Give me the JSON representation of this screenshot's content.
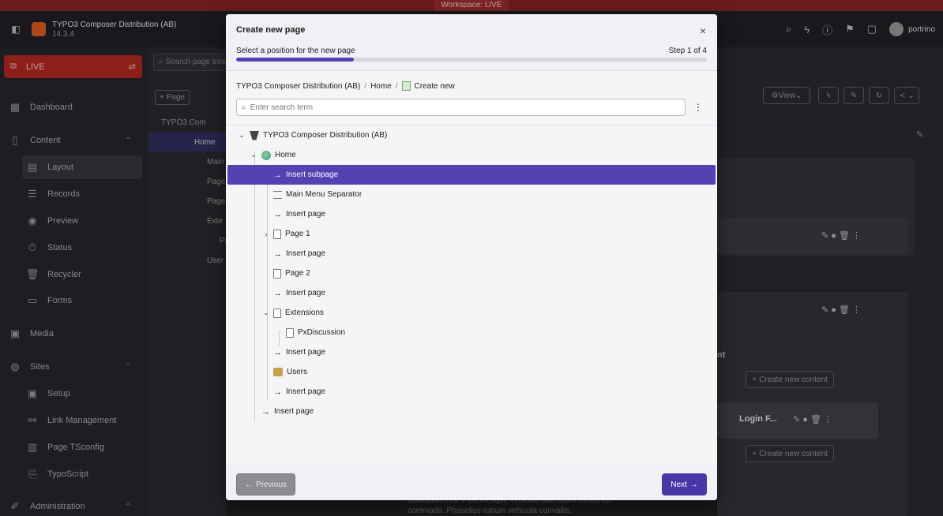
{
  "workspace": {
    "label": "Workspace: LIVE"
  },
  "topbar": {
    "site_name": "TYPO3 Composer Distribution (AB)",
    "site_version": "14.3.4",
    "user": "portrino"
  },
  "sidebar": {
    "live_label": "LIVE",
    "items": [
      {
        "label": "Dashboard",
        "icon": "dashboard-icon"
      },
      {
        "label": "Content",
        "icon": "content-icon"
      },
      {
        "label": "Layout",
        "icon": "layout-icon"
      },
      {
        "label": "Records",
        "icon": "records-icon"
      },
      {
        "label": "Preview",
        "icon": "preview-icon"
      },
      {
        "label": "Status",
        "icon": "status-icon"
      },
      {
        "label": "Recycler",
        "icon": "recycler-icon"
      },
      {
        "label": "Forms",
        "icon": "forms-icon"
      },
      {
        "label": "Media",
        "icon": "media-icon"
      },
      {
        "label": "Sites",
        "icon": "sites-icon"
      },
      {
        "label": "Setup",
        "icon": "setup-icon"
      },
      {
        "label": "Link Management",
        "icon": "link-icon"
      },
      {
        "label": "Page TSconfig",
        "icon": "tsconfig-icon"
      },
      {
        "label": "TypoScript",
        "icon": "typoscript-icon"
      },
      {
        "label": "Administration",
        "icon": "admin-icon"
      }
    ]
  },
  "pagetree": {
    "search_placeholder": "Search page tree",
    "page_button": "Page",
    "rows": [
      "TYPO3 Com",
      "Home",
      "Main",
      "Page",
      "Page",
      "Exte",
      "Px",
      "User"
    ]
  },
  "module": {
    "view_label": "View",
    "create_content": "Create new content",
    "login_item": "Login F...",
    "behind_text": "sollicitudin nisi. Pellentesque vehicula bibendum metus eu commodo. Phasellus rutrum vehicula convallis.",
    "col_title": "nt"
  },
  "modal": {
    "title": "Create new page",
    "step_label": "Select a position for the new page",
    "step_count": "Step 1 of 4",
    "progress": 0.25,
    "breadcrumb": [
      "TYPO3 Composer Distribution (AB)",
      "Home",
      "Create new"
    ],
    "search_placeholder": "Enter search term",
    "tree": [
      {
        "label": "TYPO3 Composer Distribution (AB)",
        "type": "root"
      },
      {
        "label": "Home",
        "type": "globe"
      },
      {
        "label": "Insert subpage",
        "type": "insert",
        "selected": true
      },
      {
        "label": "Main Menu Separator",
        "type": "separator"
      },
      {
        "label": "Insert page",
        "type": "insert"
      },
      {
        "label": "Page 1",
        "type": "page"
      },
      {
        "label": "Insert page",
        "type": "insert"
      },
      {
        "label": "Page 2",
        "type": "page"
      },
      {
        "label": "Insert page",
        "type": "insert"
      },
      {
        "label": "Extensions",
        "type": "page"
      },
      {
        "label": "PxDiscussion",
        "type": "page"
      },
      {
        "label": "Insert page",
        "type": "insert"
      },
      {
        "label": "Users",
        "type": "users"
      },
      {
        "label": "Insert page",
        "type": "insert"
      },
      {
        "label": "Insert page",
        "type": "insert"
      }
    ],
    "prev_label": "Previous",
    "next_label": "Next"
  }
}
